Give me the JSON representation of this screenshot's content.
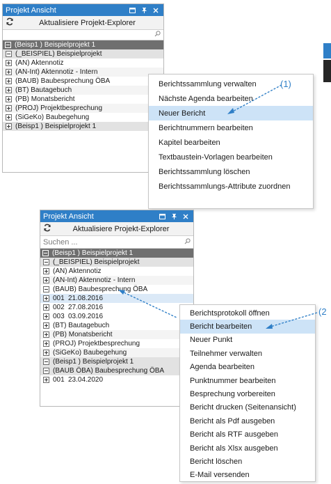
{
  "panel1": {
    "title": "Projekt Ansicht",
    "refresh_label": "Aktualisiere Projekt-Explorer",
    "tree": [
      {
        "level": 0,
        "toggle": "minus",
        "label": "(Beisp1 ) Beispielprojekt 1"
      },
      {
        "level": 1,
        "toggle": "minus",
        "label": "(_BEISPIEL) Beispielprojekt"
      },
      {
        "level": 2,
        "toggle": "plus",
        "label": "(AN) Aktennotiz"
      },
      {
        "level": 2,
        "toggle": "plus",
        "label": "(AN-Int) Aktennotiz - Intern"
      },
      {
        "level": 2,
        "toggle": "plus",
        "label": "(BAUB) Baubesprechung ÖBA"
      },
      {
        "level": 2,
        "toggle": "plus",
        "label": "(BT) Bautagebuch"
      },
      {
        "level": 2,
        "toggle": "plus",
        "label": "(PB) Monatsbericht"
      },
      {
        "level": 2,
        "toggle": "plus",
        "label": "(PROJ) Projektbesprechung"
      },
      {
        "level": 2,
        "toggle": "plus",
        "label": "(SiGeKo) Baubegehung"
      },
      {
        "level": 1,
        "toggle": "plus",
        "label": "(Beisp1 ) Beispielprojekt 1"
      }
    ]
  },
  "menu1": {
    "items": [
      "Berichtssammlung verwalten",
      "Nächste Agenda bearbeiten",
      "Neuer Bericht",
      "Berichtnummern bearbeiten",
      "Kapitel bearbeiten",
      "Textbaustein-Vorlagen bearbeiten",
      "Berichtssammlung löschen",
      "Berichtssammlungs-Attribute zuordnen"
    ],
    "highlighted": "Neuer Bericht",
    "callout": "(1)"
  },
  "panel2": {
    "title": "Projekt Ansicht",
    "refresh_label": "Aktualisiere Projekt-Explorer",
    "search_placeholder": "Suchen ...",
    "tree": [
      {
        "level": 0,
        "toggle": "minus",
        "label": "(Beisp1 ) Beispielprojekt 1"
      },
      {
        "level": 1,
        "toggle": "minus",
        "label": "(_BEISPIEL) Beispielprojekt"
      },
      {
        "level": 2,
        "toggle": "plus",
        "label": "(AN) Aktennotiz"
      },
      {
        "level": 2,
        "toggle": "plus",
        "label": "(AN-Int) Aktennotiz - Intern"
      },
      {
        "level": 2,
        "toggle": "minus",
        "label": "(BAUB) Baubesprechung ÖBA"
      },
      {
        "level": 3,
        "toggle": "plus",
        "num": "001",
        "label": "21.08.2016",
        "selected": true
      },
      {
        "level": 3,
        "toggle": "plus",
        "num": "002",
        "label": "27.08.2016"
      },
      {
        "level": 3,
        "toggle": "plus",
        "num": "003",
        "label": "03.09.2016"
      },
      {
        "level": 2,
        "toggle": "plus",
        "label": "(BT) Bautagebuch"
      },
      {
        "level": 2,
        "toggle": "plus",
        "label": "(PB) Monatsbericht"
      },
      {
        "level": 2,
        "toggle": "plus",
        "label": "(PROJ) Projektbesprechung"
      },
      {
        "level": 2,
        "toggle": "plus",
        "label": "(SiGeKo) Baubegehung"
      },
      {
        "level": 1,
        "toggle": "minus",
        "label": "(Beisp1 ) Beispielprojekt 1"
      },
      {
        "level": 1,
        "toggle": "minus",
        "label": "(BAUB ÖBA) Baubesprechung ÖBA"
      },
      {
        "level": 3,
        "toggle": "plus",
        "num": "001",
        "label": "23.04.2020"
      }
    ]
  },
  "menu2": {
    "items": [
      "Berichtsprotokoll öffnen",
      "Bericht bearbeiten",
      "Neuer Punkt",
      "Teilnehmer verwalten",
      "Agenda bearbeiten",
      "Punktnummer bearbeiten",
      "Besprechung vorbereiten",
      "Bericht drucken (Seitenansicht)",
      "Bericht als Pdf ausgeben",
      "Bericht als RTF ausgeben",
      "Bericht als Xlsx ausgeben",
      "Bericht löschen",
      "E-Mail versenden"
    ],
    "highlighted": "Bericht bearbeiten",
    "callout": "(2"
  },
  "colors": {
    "accent": "#2f7fc7",
    "highlight": "#cde3f7",
    "header_gray": "#6f6f6f"
  },
  "icons": {
    "refresh": "refresh-icon",
    "search": "search-icon",
    "pin": "pin-icon",
    "close": "close-icon",
    "dock": "dock-icon"
  }
}
